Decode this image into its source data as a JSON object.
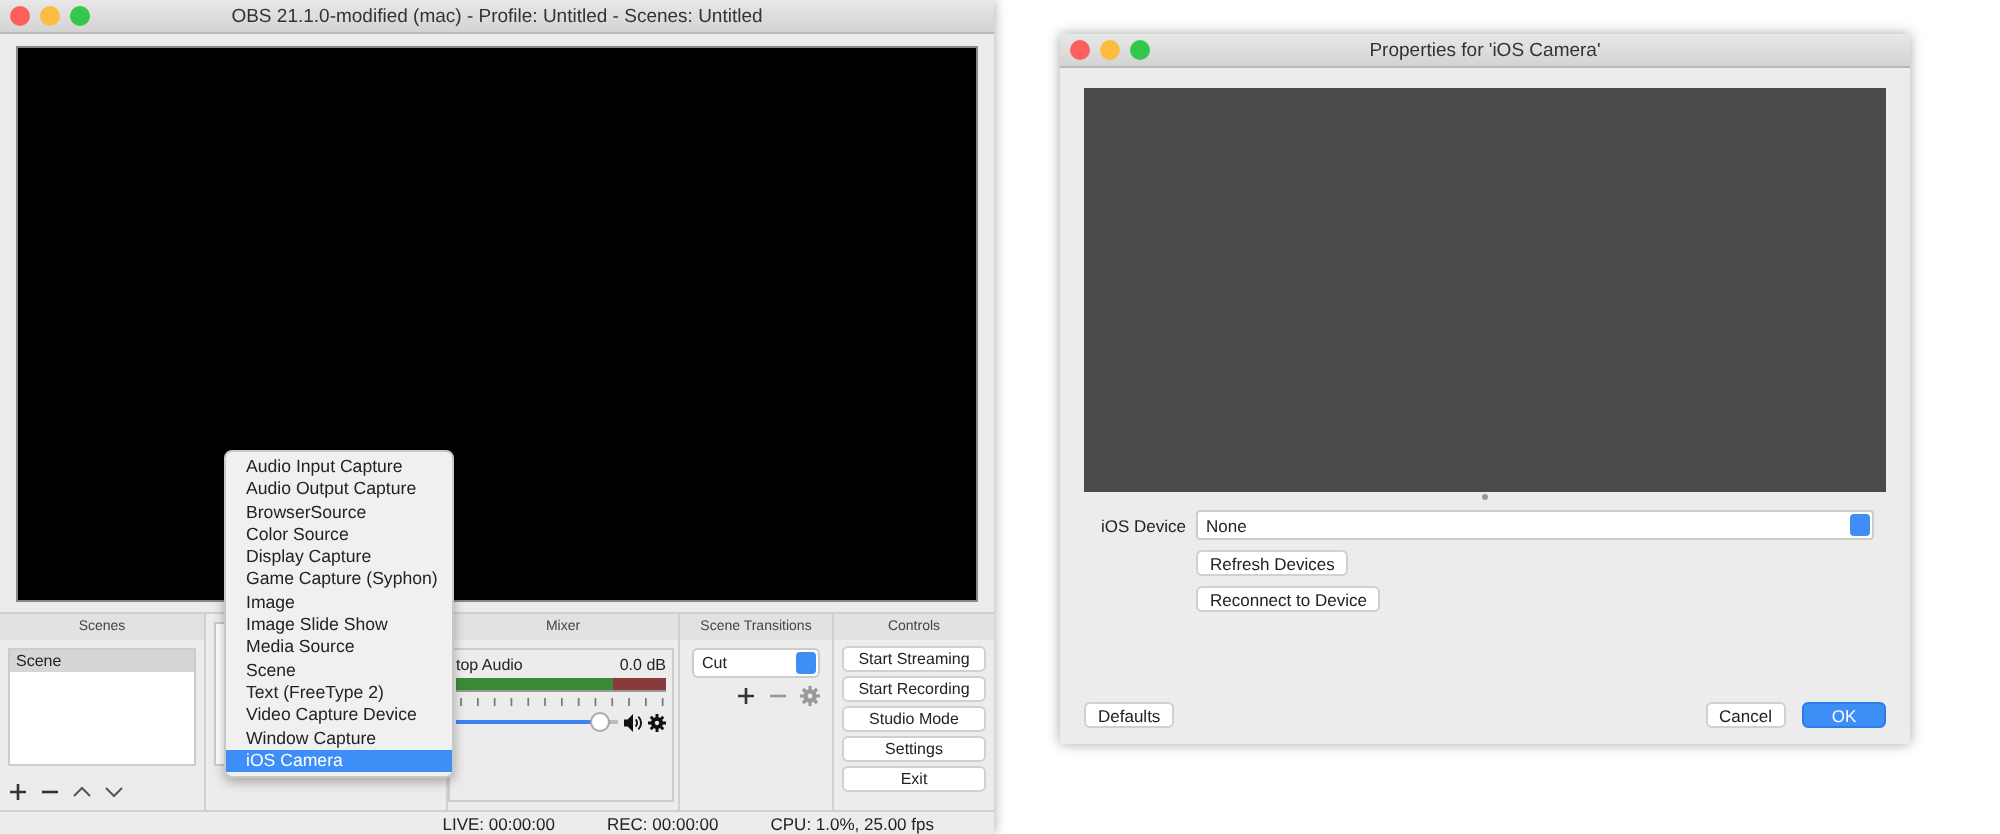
{
  "obs_window": {
    "title": "OBS 21.1.0-modified (mac) - Profile: Untitled - Scenes: Untitled",
    "scenes": {
      "header": "Scenes",
      "items": [
        {
          "label": "Scene",
          "selected": true
        }
      ]
    },
    "mixer": {
      "header": "Mixer",
      "channel": {
        "name": "top Audio",
        "reading": "0.0 dB",
        "level": 0.95
      }
    },
    "transitions": {
      "header": "Scene Transitions",
      "value": "Cut"
    },
    "controls": {
      "header": "Controls",
      "buttons": [
        "Start Streaming",
        "Start Recording",
        "Studio Mode",
        "Settings",
        "Exit"
      ]
    },
    "status_bar": {
      "live": "LIVE: 00:00:00",
      "rec": "REC: 00:00:00",
      "cpu": "CPU: 1.0%, 25.00 fps"
    }
  },
  "add_source_menu": {
    "items": [
      {
        "label": "Audio Input Capture",
        "selected": false
      },
      {
        "label": "Audio Output Capture",
        "selected": false
      },
      {
        "label": "BrowserSource",
        "selected": false
      },
      {
        "label": "Color Source",
        "selected": false
      },
      {
        "label": "Display Capture",
        "selected": false
      },
      {
        "label": "Game Capture (Syphon)",
        "selected": false
      },
      {
        "label": "Image",
        "selected": false
      },
      {
        "label": "Image Slide Show",
        "selected": false
      },
      {
        "label": "Media Source",
        "selected": false
      },
      {
        "label": "Scene",
        "selected": false
      },
      {
        "label": "Text (FreeType 2)",
        "selected": false
      },
      {
        "label": "Video Capture Device",
        "selected": false
      },
      {
        "label": "Window Capture",
        "selected": false
      },
      {
        "label": "iOS Camera",
        "selected": true
      }
    ]
  },
  "properties_dialog": {
    "title": "Properties for 'iOS Camera'",
    "device_label": "iOS Device",
    "device_value": "None",
    "actions": [
      "Refresh Devices",
      "Reconnect to Device"
    ],
    "defaults": "Defaults",
    "cancel": "Cancel",
    "ok": "OK"
  }
}
